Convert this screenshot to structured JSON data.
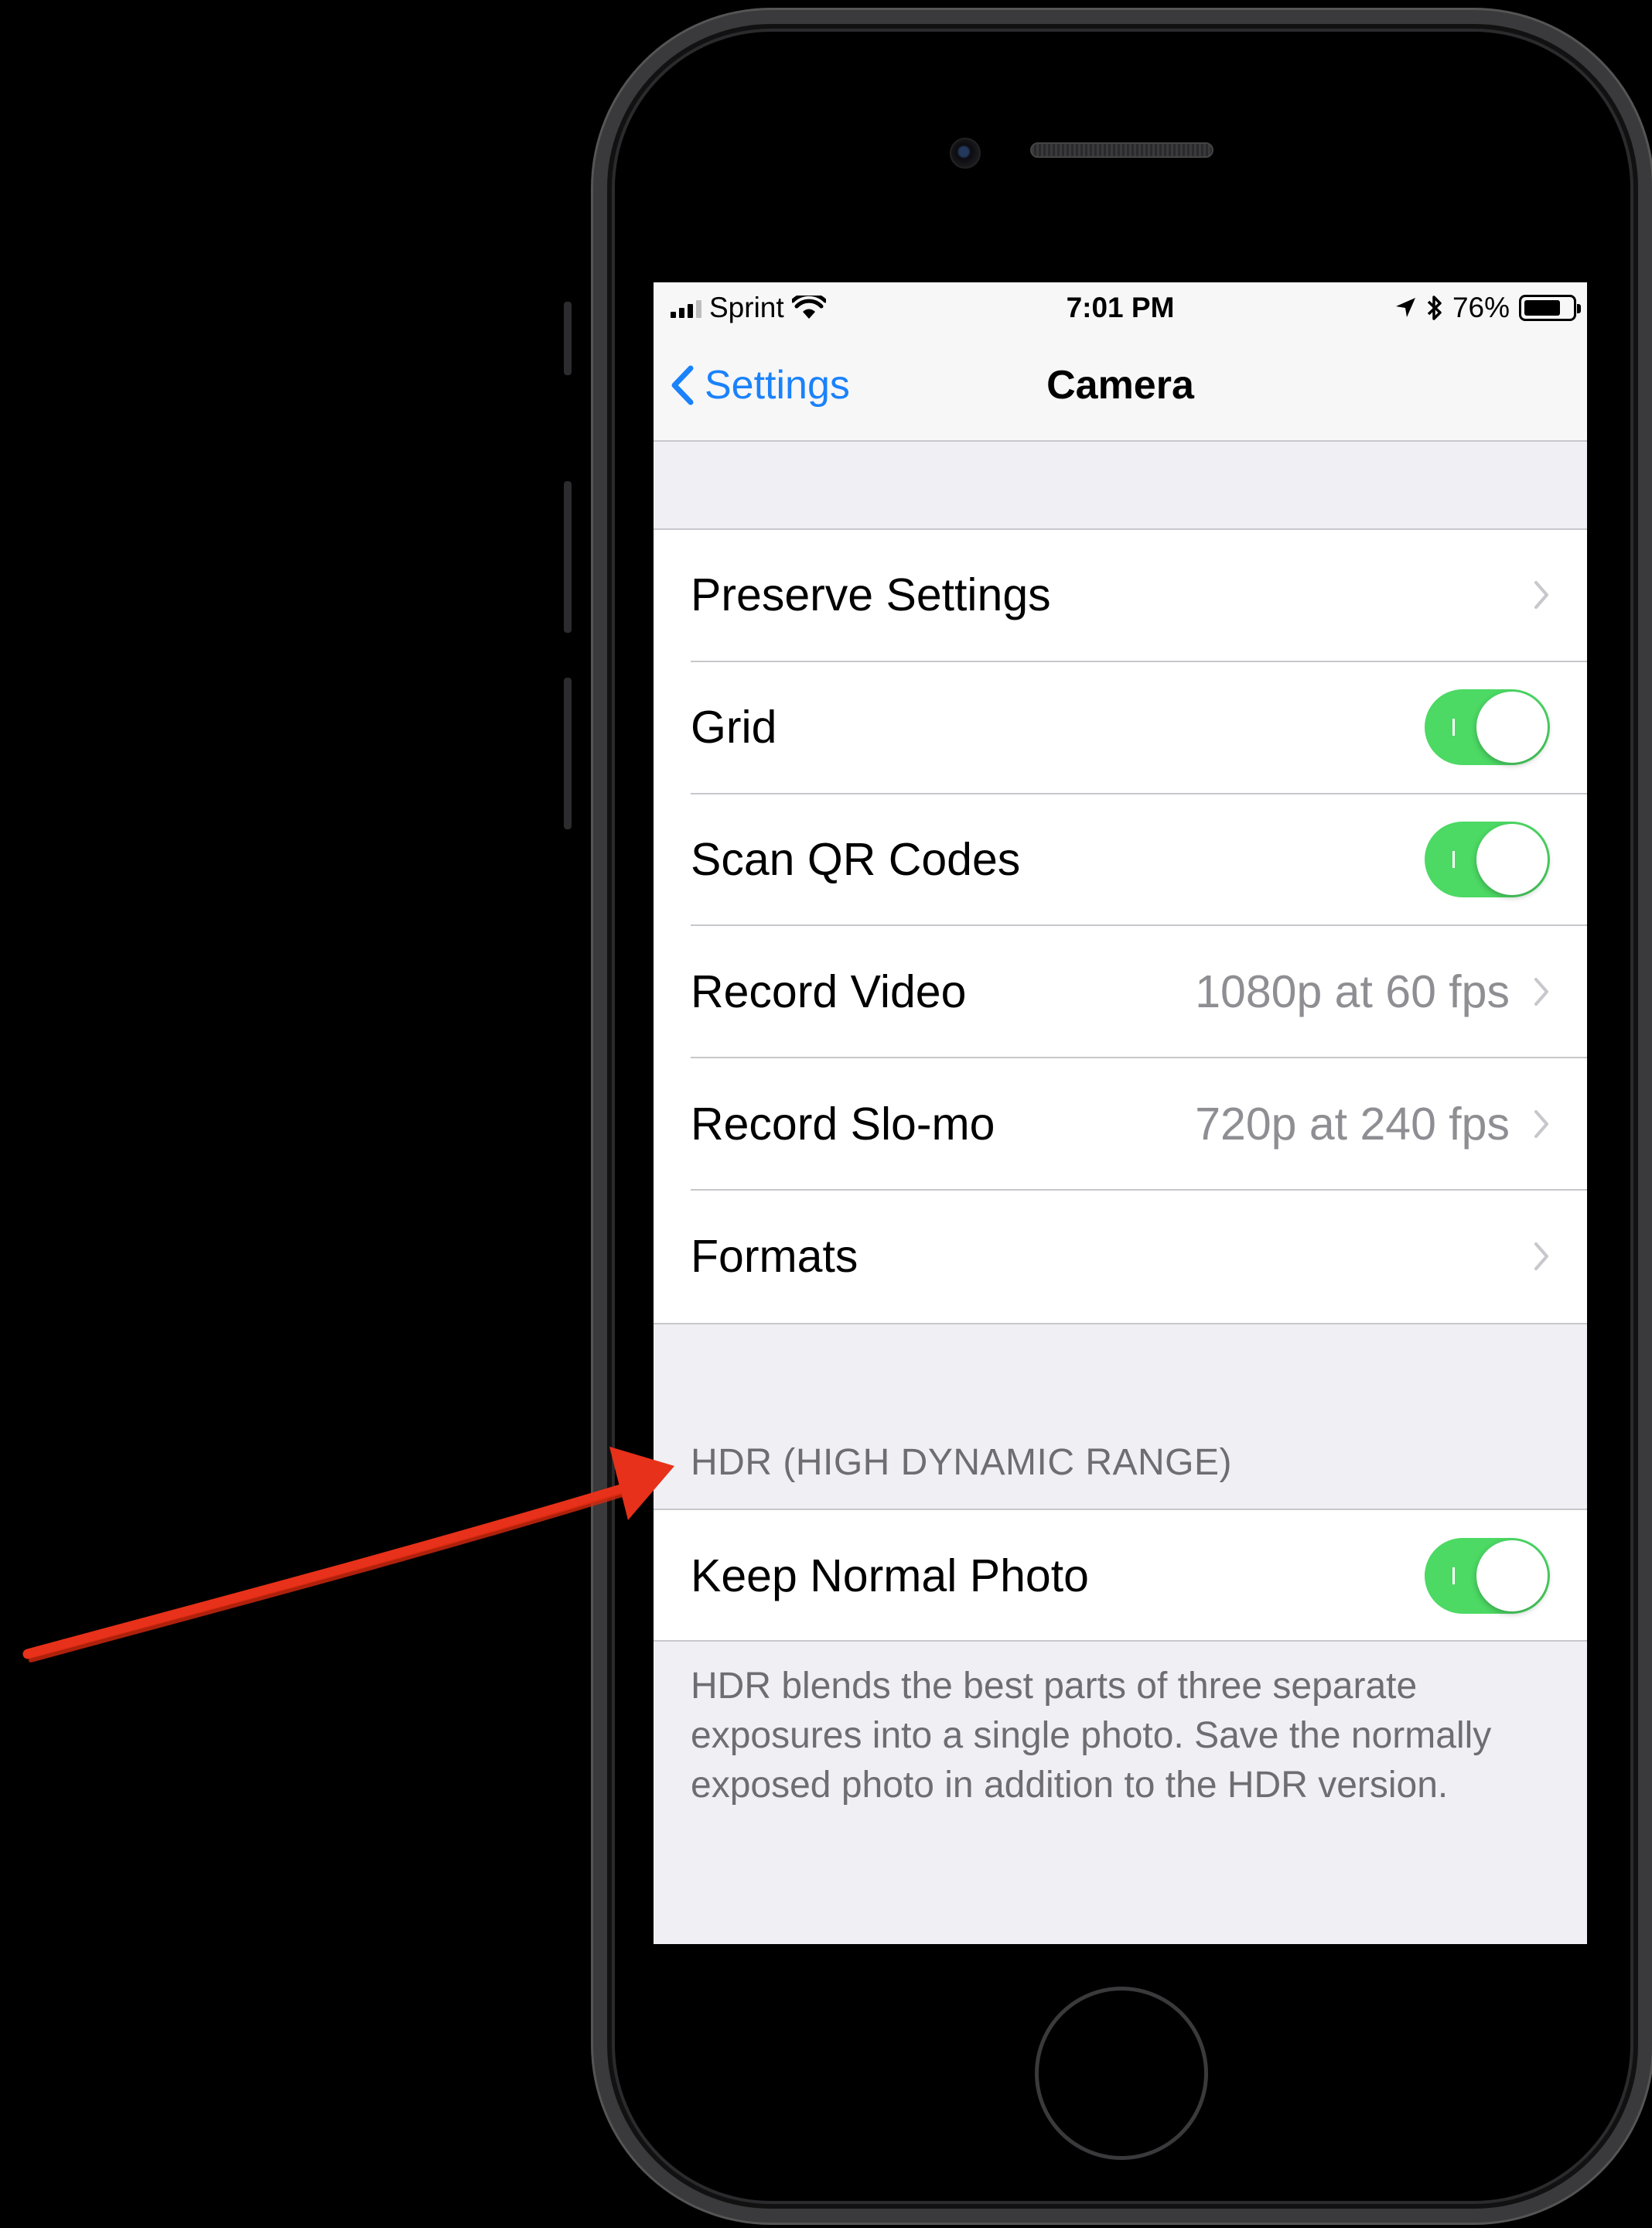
{
  "status_bar": {
    "carrier": "Sprint",
    "time": "7:01 PM",
    "battery_percent": "76%",
    "battery_level": 0.76,
    "icons": [
      "signal-icon",
      "wifi-icon",
      "location-icon",
      "bluetooth-icon",
      "battery-icon"
    ]
  },
  "nav": {
    "back_label": "Settings",
    "title": "Camera"
  },
  "settings": {
    "rows": [
      {
        "label": "Preserve Settings",
        "value": "",
        "control": "chevron"
      },
      {
        "label": "Grid",
        "value": "",
        "control": "toggle",
        "on": true
      },
      {
        "label": "Scan QR Codes",
        "value": "",
        "control": "toggle",
        "on": true
      },
      {
        "label": "Record Video",
        "value": "1080p at 60 fps",
        "control": "chevron"
      },
      {
        "label": "Record Slo-mo",
        "value": "720p at 240 fps",
        "control": "chevron"
      },
      {
        "label": "Formats",
        "value": "",
        "control": "chevron"
      }
    ]
  },
  "hdr": {
    "header": "HDR (HIGH DYNAMIC RANGE)",
    "row_label": "Keep Normal Photo",
    "row_on": true,
    "footer": "HDR blends the best parts of three separate exposures into a single photo. Save the normally exposed photo in addition to the HDR version."
  },
  "colors": {
    "accent": "#1a82fb",
    "toggle_on": "#4cd964",
    "annotation_arrow": "#e8311a"
  }
}
